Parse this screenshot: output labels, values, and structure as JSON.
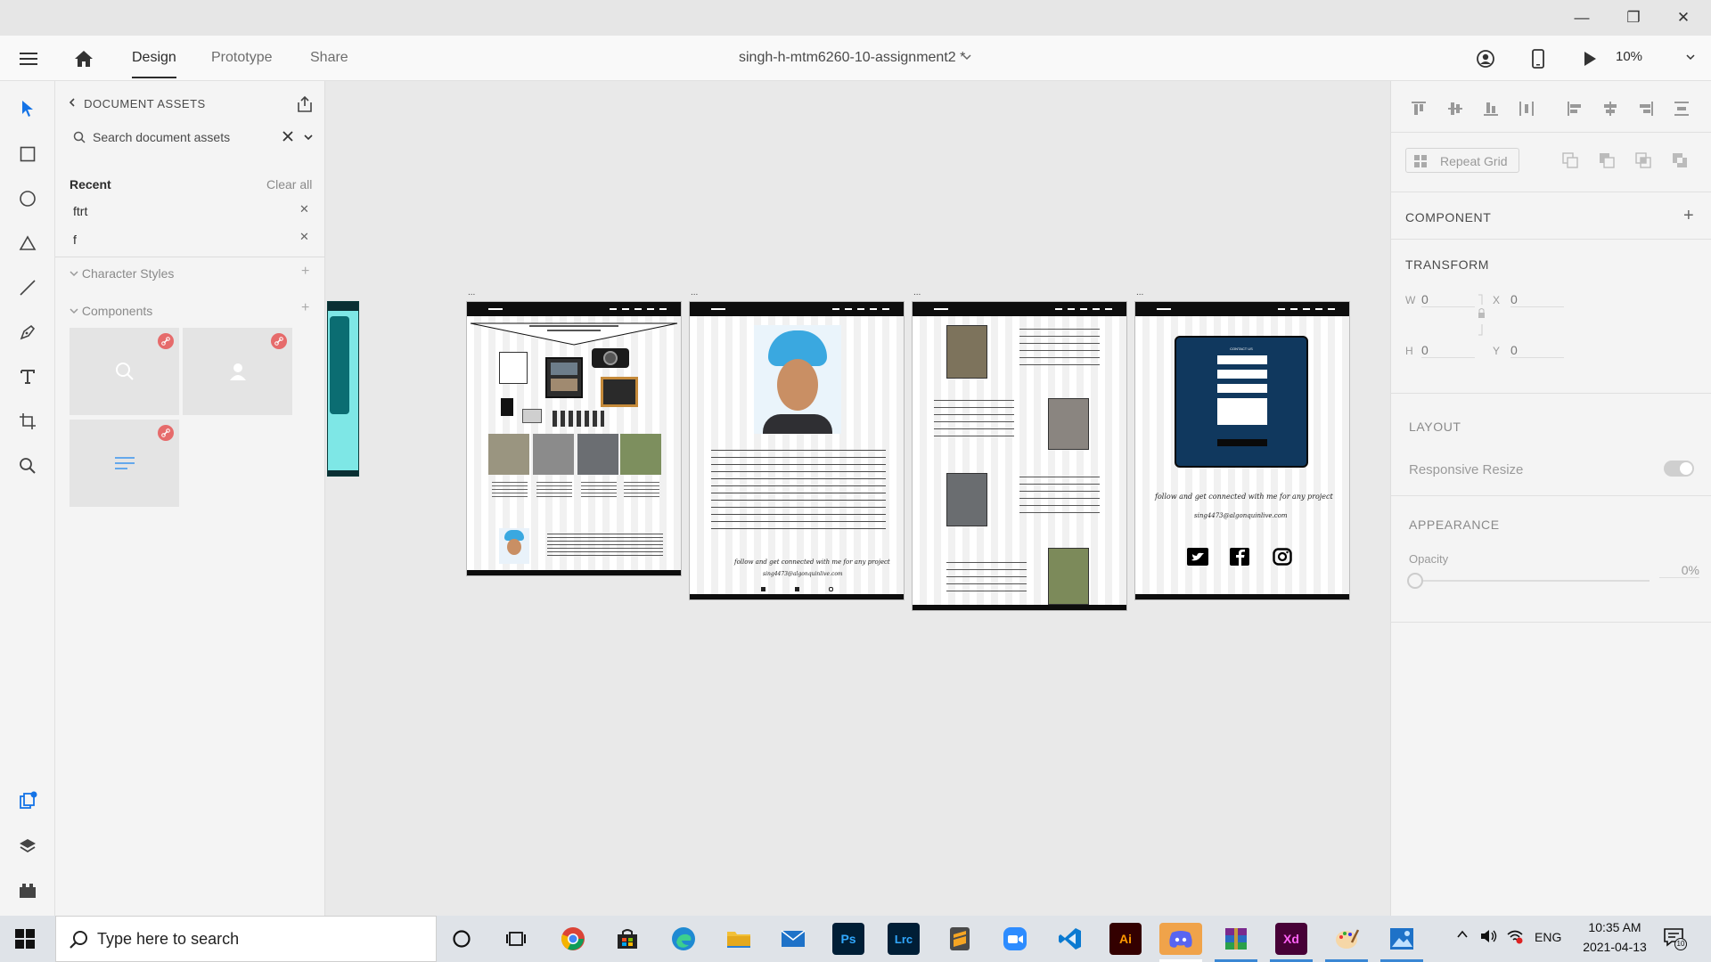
{
  "window": {
    "title_controls": {
      "minimize": "—",
      "restore": "❐",
      "close": "✕"
    }
  },
  "header": {
    "tabs": [
      {
        "label": "Design",
        "active": true
      },
      {
        "label": "Prototype",
        "active": false
      },
      {
        "label": "Share",
        "active": false
      }
    ],
    "doc_title": "singh-h-mtm6260-10-assignment2 *",
    "zoom": "10%"
  },
  "tools": [
    "select-icon",
    "rectangle-icon",
    "ellipse-icon",
    "polygon-icon",
    "line-icon",
    "pen-icon",
    "text-icon",
    "artboard-icon",
    "zoom-icon"
  ],
  "assets": {
    "heading": "DOCUMENT ASSETS",
    "search_placeholder": "Search document assets",
    "recent_label": "Recent",
    "clear_all": "Clear all",
    "recent_items": [
      "ftrt",
      "f"
    ],
    "character_styles": "Character Styles",
    "components": "Components"
  },
  "canvas": {
    "artboards": [
      {
        "id": "home",
        "caption": "..."
      },
      {
        "id": "about",
        "caption": "...",
        "script_line": "follow and get connected with me for any project",
        "email_line": "sing4473@algonquinlive.com"
      },
      {
        "id": "portfolio",
        "caption": "..."
      },
      {
        "id": "contact",
        "caption": "...",
        "form_title": "CONTACT US",
        "script_line": "follow and get connected with me for any project",
        "email_line": "sing4473@algonquinlive.com"
      }
    ]
  },
  "props": {
    "repeat_grid": "Repeat Grid",
    "component": "COMPONENT",
    "transform": "TRANSFORM",
    "w_label": "W",
    "w_value": "0",
    "h_label": "H",
    "h_value": "0",
    "x_label": "X",
    "x_value": "0",
    "y_label": "Y",
    "y_value": "0",
    "layout": "LAYOUT",
    "responsive_resize": "Responsive Resize",
    "appearance": "APPEARANCE",
    "opacity_label": "Opacity",
    "opacity_value": "0%"
  },
  "taskbar": {
    "search_placeholder": "Type here to search",
    "apps": [
      "Chrome",
      "Store",
      "Edge",
      "File Explorer",
      "Mail",
      "Ps",
      "Lrc",
      "Sublime",
      "Zoom",
      "VS Code",
      "Ai",
      "Discord",
      "WinRAR",
      "Xd",
      "Paint",
      "Photos"
    ],
    "lang": "ENG",
    "time": "10:35 AM",
    "date": "2021-04-13",
    "notif_count": "10"
  },
  "colors": {
    "accent": "#1473e6",
    "xd": "#470137",
    "xd_text": "#ff61f6"
  }
}
